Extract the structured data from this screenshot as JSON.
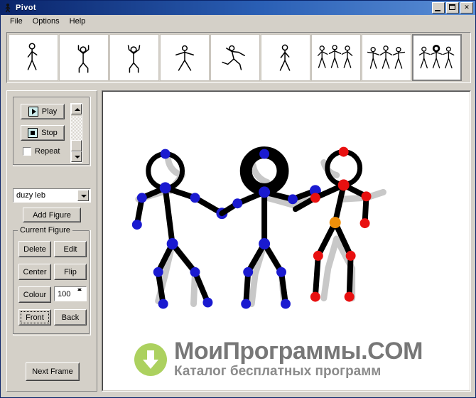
{
  "window": {
    "title": "Pivot",
    "icon": "stickman-icon",
    "controls": {
      "minimize": "Minimize",
      "maximize": "Maximize",
      "close": "Close",
      "close_glyph": "✕"
    }
  },
  "menu": {
    "items": [
      "File",
      "Options",
      "Help"
    ]
  },
  "frames": {
    "count": 9,
    "selected_index": 8,
    "items": [
      {
        "name": "frame-1",
        "pose": "standing"
      },
      {
        "name": "frame-2",
        "pose": "arms-up"
      },
      {
        "name": "frame-3",
        "pose": "arms-up-2"
      },
      {
        "name": "frame-4",
        "pose": "arms-out"
      },
      {
        "name": "frame-5",
        "pose": "running"
      },
      {
        "name": "frame-6",
        "pose": "walking"
      },
      {
        "name": "frame-7",
        "pose": "three-figures-a"
      },
      {
        "name": "frame-8",
        "pose": "three-figures-b"
      },
      {
        "name": "frame-9",
        "pose": "three-figures-selected"
      }
    ]
  },
  "playback": {
    "play_label": "Play",
    "stop_label": "Stop",
    "repeat_label": "Repeat",
    "repeat_checked": false
  },
  "figure_select": {
    "value": "duzy leb",
    "add_figure_label": "Add Figure"
  },
  "current_figure": {
    "group_label": "Current Figure",
    "delete_label": "Delete",
    "edit_label": "Edit",
    "center_label": "Center",
    "flip_label": "Flip",
    "colour_label": "Colour",
    "scale_value": "100",
    "front_label": "Front",
    "back_label": "Back",
    "focused_button": "Front"
  },
  "timeline": {
    "next_frame_label": "Next Frame"
  },
  "watermark": {
    "title": "МоиПрограммы.COM",
    "subtitle": "Каталог бесплатных программ",
    "icon": "download-circle-icon",
    "icon_color": "#a8cf57",
    "title_color": "#777777"
  },
  "colors": {
    "titlebar_start": "#0a246a",
    "titlebar_end": "#5a8ed6",
    "face": "#d4d0c8",
    "canvas": "#ffffff",
    "joint_blue": "#1a1ad0",
    "joint_red": "#e81010",
    "joint_orange": "#f0900a",
    "segment": "#000000",
    "ghost": "#c8c8c8"
  },
  "canvas_figures": [
    {
      "name": "figure-left",
      "joint_color": "#1a1ad0",
      "head": "thin",
      "ghost": true
    },
    {
      "name": "figure-middle",
      "joint_color": "#1a1ad0",
      "head": "thick",
      "ghost": true
    },
    {
      "name": "figure-right",
      "joint_color": "#e81010",
      "head": "thin",
      "ghost": true,
      "root_joint_color": "#f0900a"
    }
  ]
}
